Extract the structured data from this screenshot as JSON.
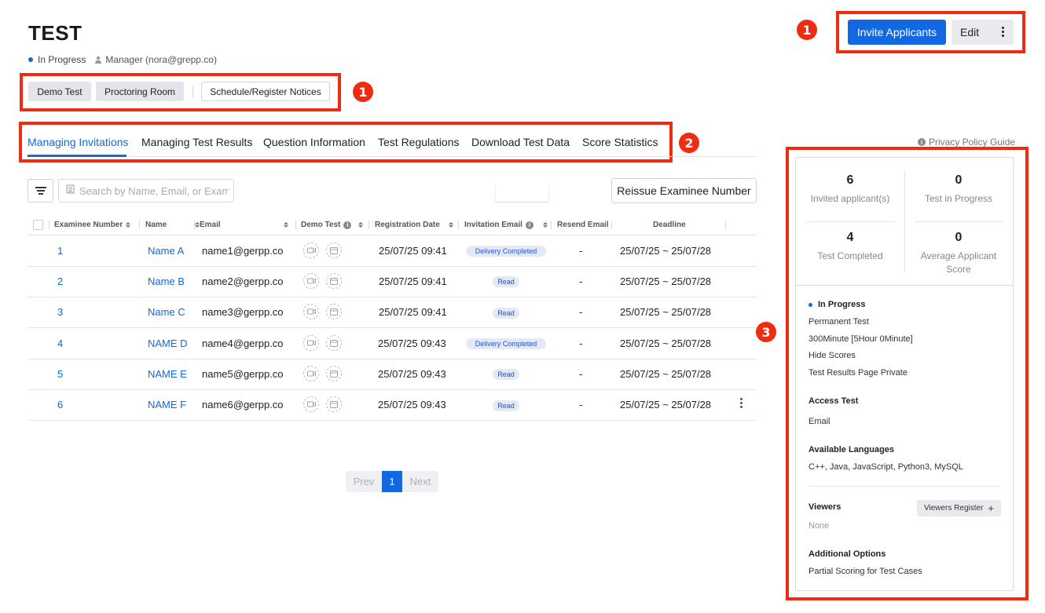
{
  "header": {
    "title": "TEST",
    "status": "In Progress",
    "manager": "Manager (nora@grepp.co)",
    "invite_label": "Invite Applicants",
    "edit_label": "Edit"
  },
  "actions": {
    "demo_test": "Demo Test",
    "proctoring_room": "Proctoring Room",
    "schedule_notices": "Schedule/Register Notices"
  },
  "annotations": [
    "1",
    "2",
    "3"
  ],
  "tabs": [
    {
      "label": "Managing Invitations"
    },
    {
      "label": "Managing Test Results"
    },
    {
      "label": "Question Information"
    },
    {
      "label": "Test Regulations"
    },
    {
      "label": "Download Test Data"
    },
    {
      "label": "Score Statistics"
    }
  ],
  "privacy_link": "Privacy Policy Guide",
  "toolbar": {
    "search_placeholder": "Search by Name, Email, or Exam",
    "reissue_label": "Reissue Examinee Number"
  },
  "table": {
    "columns": [
      "Examinee Number",
      "Name",
      "Email",
      "Demo Test",
      "Registration Date",
      "Invitation Email",
      "Resend Email",
      "Deadline"
    ],
    "rows": [
      {
        "no": "1",
        "name": "Name A",
        "email": "name1@gerpp.co",
        "date": "25/07/25 09:41",
        "status": "Delivery Completed",
        "resend": "-",
        "deadline": "25/07/25 ~ 25/07/28"
      },
      {
        "no": "2",
        "name": "Name B",
        "email": "name2@gerpp.co",
        "date": "25/07/25 09:41",
        "status": "Read",
        "resend": "-",
        "deadline": "25/07/25 ~ 25/07/28"
      },
      {
        "no": "3",
        "name": "Name C",
        "email": "name3@gerpp.co",
        "date": "25/07/25 09:41",
        "status": "Read",
        "resend": "-",
        "deadline": "25/07/25 ~ 25/07/28"
      },
      {
        "no": "4",
        "name": "NAME D",
        "email": "name4@gerpp.co",
        "date": "25/07/25 09:43",
        "status": "Delivery Completed",
        "resend": "-",
        "deadline": "25/07/25 ~ 25/07/28"
      },
      {
        "no": "5",
        "name": "NAME E",
        "email": "name5@gerpp.co",
        "date": "25/07/25 09:43",
        "status": "Read",
        "resend": "-",
        "deadline": "25/07/25 ~ 25/07/28"
      },
      {
        "no": "6",
        "name": "NAME F",
        "email": "name6@gerpp.co",
        "date": "25/07/25 09:43",
        "status": "Read",
        "resend": "-",
        "deadline": "25/07/25 ~ 25/07/28"
      }
    ]
  },
  "pagination": {
    "prev": "Prev",
    "current": "1",
    "next": "Next"
  },
  "panel": {
    "stats": [
      {
        "value": "6",
        "label": "Invited applicant(s)"
      },
      {
        "value": "0",
        "label": "Test in Progress"
      },
      {
        "value": "4",
        "label": "Test Completed"
      },
      {
        "value": "0",
        "label": "Average Applicant Score"
      }
    ],
    "status": "In Progress",
    "details": [
      "Permanent Test",
      "300Minute [5Hour 0Minute]",
      "Hide Scores",
      "Test Results Page Private"
    ],
    "access_title": "Access Test",
    "access_value": "Email",
    "languages_title": "Available Languages",
    "languages_value": "C++, Java, JavaScript, Python3, MySQL",
    "viewers_title": "Viewers",
    "viewers_button": "Viewers Register",
    "viewers_value": "None",
    "options_title": "Additional Options",
    "options_value": "Partial Scoring for Test Cases"
  },
  "colors": {
    "accent": "#1268e3",
    "annotation": "#ef2b12",
    "pill_bg": "#e4e9f8"
  }
}
